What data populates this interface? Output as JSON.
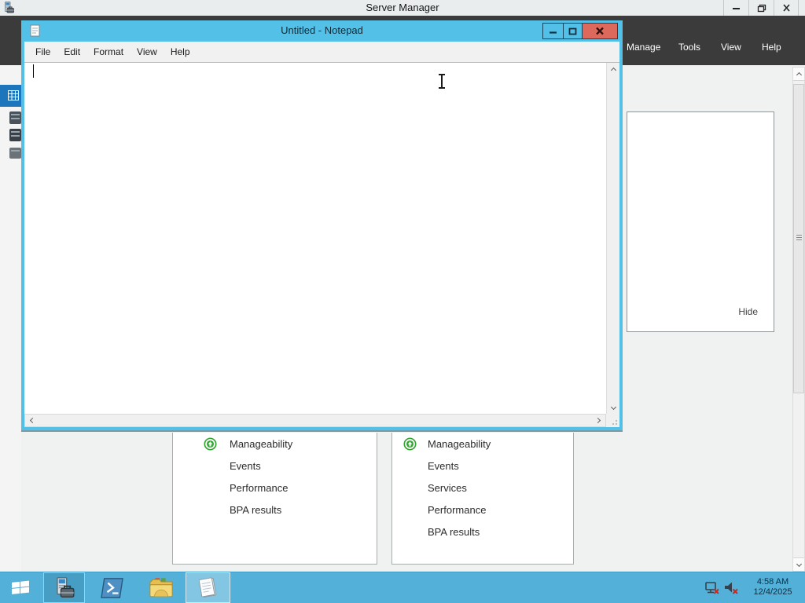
{
  "server_manager_window": {
    "title": "Server Manager",
    "menu_items": [
      "Manage",
      "Tools",
      "View",
      "Help"
    ],
    "panel": {
      "hide_label": "Hide"
    },
    "tiles": [
      {
        "rows": [
          {
            "icon": "status-up-icon",
            "label": "Manageability"
          },
          {
            "label": "Events"
          },
          {
            "label": "Performance"
          },
          {
            "label": "BPA results"
          }
        ]
      },
      {
        "rows": [
          {
            "icon": "status-up-icon",
            "label": "Manageability"
          },
          {
            "label": "Events"
          },
          {
            "label": "Services"
          },
          {
            "label": "Performance"
          },
          {
            "label": "BPA results"
          }
        ]
      }
    ]
  },
  "notepad_window": {
    "title": "Untitled - Notepad",
    "menu_items": [
      "File",
      "Edit",
      "Format",
      "View",
      "Help"
    ],
    "text_content": ""
  },
  "taskbar": {
    "time": "4:58 AM",
    "date": "12/4/2025"
  },
  "icons": {
    "status_up": "green-circle-up-arrow",
    "network": "network-disconnected",
    "volume": "volume-muted"
  },
  "colors": {
    "taskbar_blue": "#53b1d9",
    "notepad_chrome": "#53c0e8",
    "close_button_red": "#dc695c",
    "dark_menubar": "#3b3b3b",
    "selection_blue": "#1d76bb",
    "status_green": "#33a532"
  }
}
